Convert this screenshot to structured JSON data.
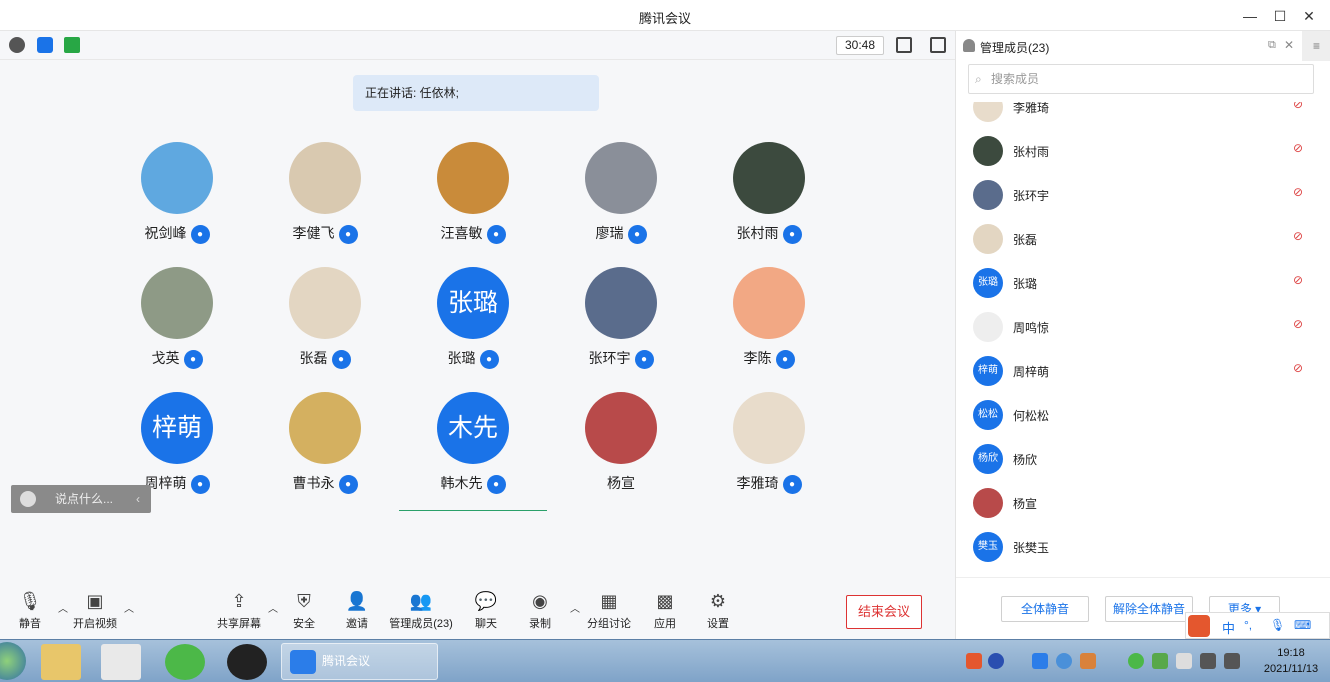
{
  "window": {
    "title": "腾讯会议",
    "minimize": "—",
    "maximize": "☐",
    "close": "✕"
  },
  "topbar": {
    "timer": "30:48"
  },
  "speaking": "正在讲话: 任依林;",
  "participants": [
    {
      "name": "祝剑峰",
      "avatar_text": "",
      "color": "#5fa8e0"
    },
    {
      "name": "李健飞",
      "avatar_text": "",
      "color": "#d9c9b0"
    },
    {
      "name": "汪喜敏",
      "avatar_text": "",
      "color": "#c98b3a"
    },
    {
      "name": "廖瑞",
      "avatar_text": "",
      "color": "#8a8f99"
    },
    {
      "name": "张村雨",
      "avatar_text": "",
      "color": "#3c4a3e"
    },
    {
      "name": "戈英",
      "avatar_text": "",
      "color": "#8e9a86"
    },
    {
      "name": "张磊",
      "avatar_text": "",
      "color": "#e3d6c2"
    },
    {
      "name": "张璐",
      "avatar_text": "张璐",
      "color": "#1a73e8"
    },
    {
      "name": "张环宇",
      "avatar_text": "",
      "color": "#5a6c8c"
    },
    {
      "name": "李陈",
      "avatar_text": "",
      "color": "#f2a884"
    },
    {
      "name": "周梓萌",
      "avatar_text": "梓萌",
      "color": "#1a73e8"
    },
    {
      "name": "曹书永",
      "avatar_text": "",
      "color": "#d4b060"
    },
    {
      "name": "韩木先",
      "avatar_text": "木先",
      "color": "#1a73e8"
    },
    {
      "name": "杨宣",
      "avatar_text": "",
      "color": "#b84a4a"
    },
    {
      "name": "李雅琦",
      "avatar_text": "",
      "color": "#e8dccb"
    }
  ],
  "chat": {
    "placeholder": "说点什么...",
    "collapse": "‹"
  },
  "toolbar": {
    "mute": "静音",
    "video": "开启视频",
    "share": "共享屏幕",
    "security": "安全",
    "invite": "邀请",
    "members": "管理成员(23)",
    "chat": "聊天",
    "record": "录制",
    "breakout": "分组讨论",
    "apps": "应用",
    "settings": "设置",
    "end": "结束会议"
  },
  "panel": {
    "title": "管理成员(23)",
    "search_placeholder": "搜索成员",
    "members": [
      {
        "name": "李雅琦",
        "avatar_text": "",
        "color": "#e8dccb",
        "muted": true
      },
      {
        "name": "张村雨",
        "avatar_text": "",
        "color": "#3c4a3e",
        "muted": true
      },
      {
        "name": "张环宇",
        "avatar_text": "",
        "color": "#5a6c8c",
        "muted": true
      },
      {
        "name": "张磊",
        "avatar_text": "",
        "color": "#e3d6c2",
        "muted": true
      },
      {
        "name": "张璐",
        "avatar_text": "张璐",
        "color": "#1a73e8",
        "muted": true
      },
      {
        "name": "周鸣惊",
        "avatar_text": "",
        "color": "#eeeeee",
        "muted": true
      },
      {
        "name": "周梓萌",
        "avatar_text": "梓萌",
        "color": "#1a73e8",
        "muted": true
      },
      {
        "name": "何松松",
        "avatar_text": "松松",
        "color": "#1a73e8",
        "muted": false
      },
      {
        "name": "杨欣",
        "avatar_text": "杨欣",
        "color": "#1a73e8",
        "muted": false
      },
      {
        "name": "杨宣",
        "avatar_text": "",
        "color": "#b84a4a",
        "muted": false
      },
      {
        "name": "张樊玉",
        "avatar_text": "樊玉",
        "color": "#1a73e8",
        "muted": false
      }
    ],
    "mute_all": "全体静音",
    "unmute_all": "解除全体静音",
    "more": "更多 ▾"
  },
  "taskbar": {
    "active_app": "腾讯会议",
    "time": "19:18",
    "date": "2021/11/13",
    "ime": "中"
  }
}
